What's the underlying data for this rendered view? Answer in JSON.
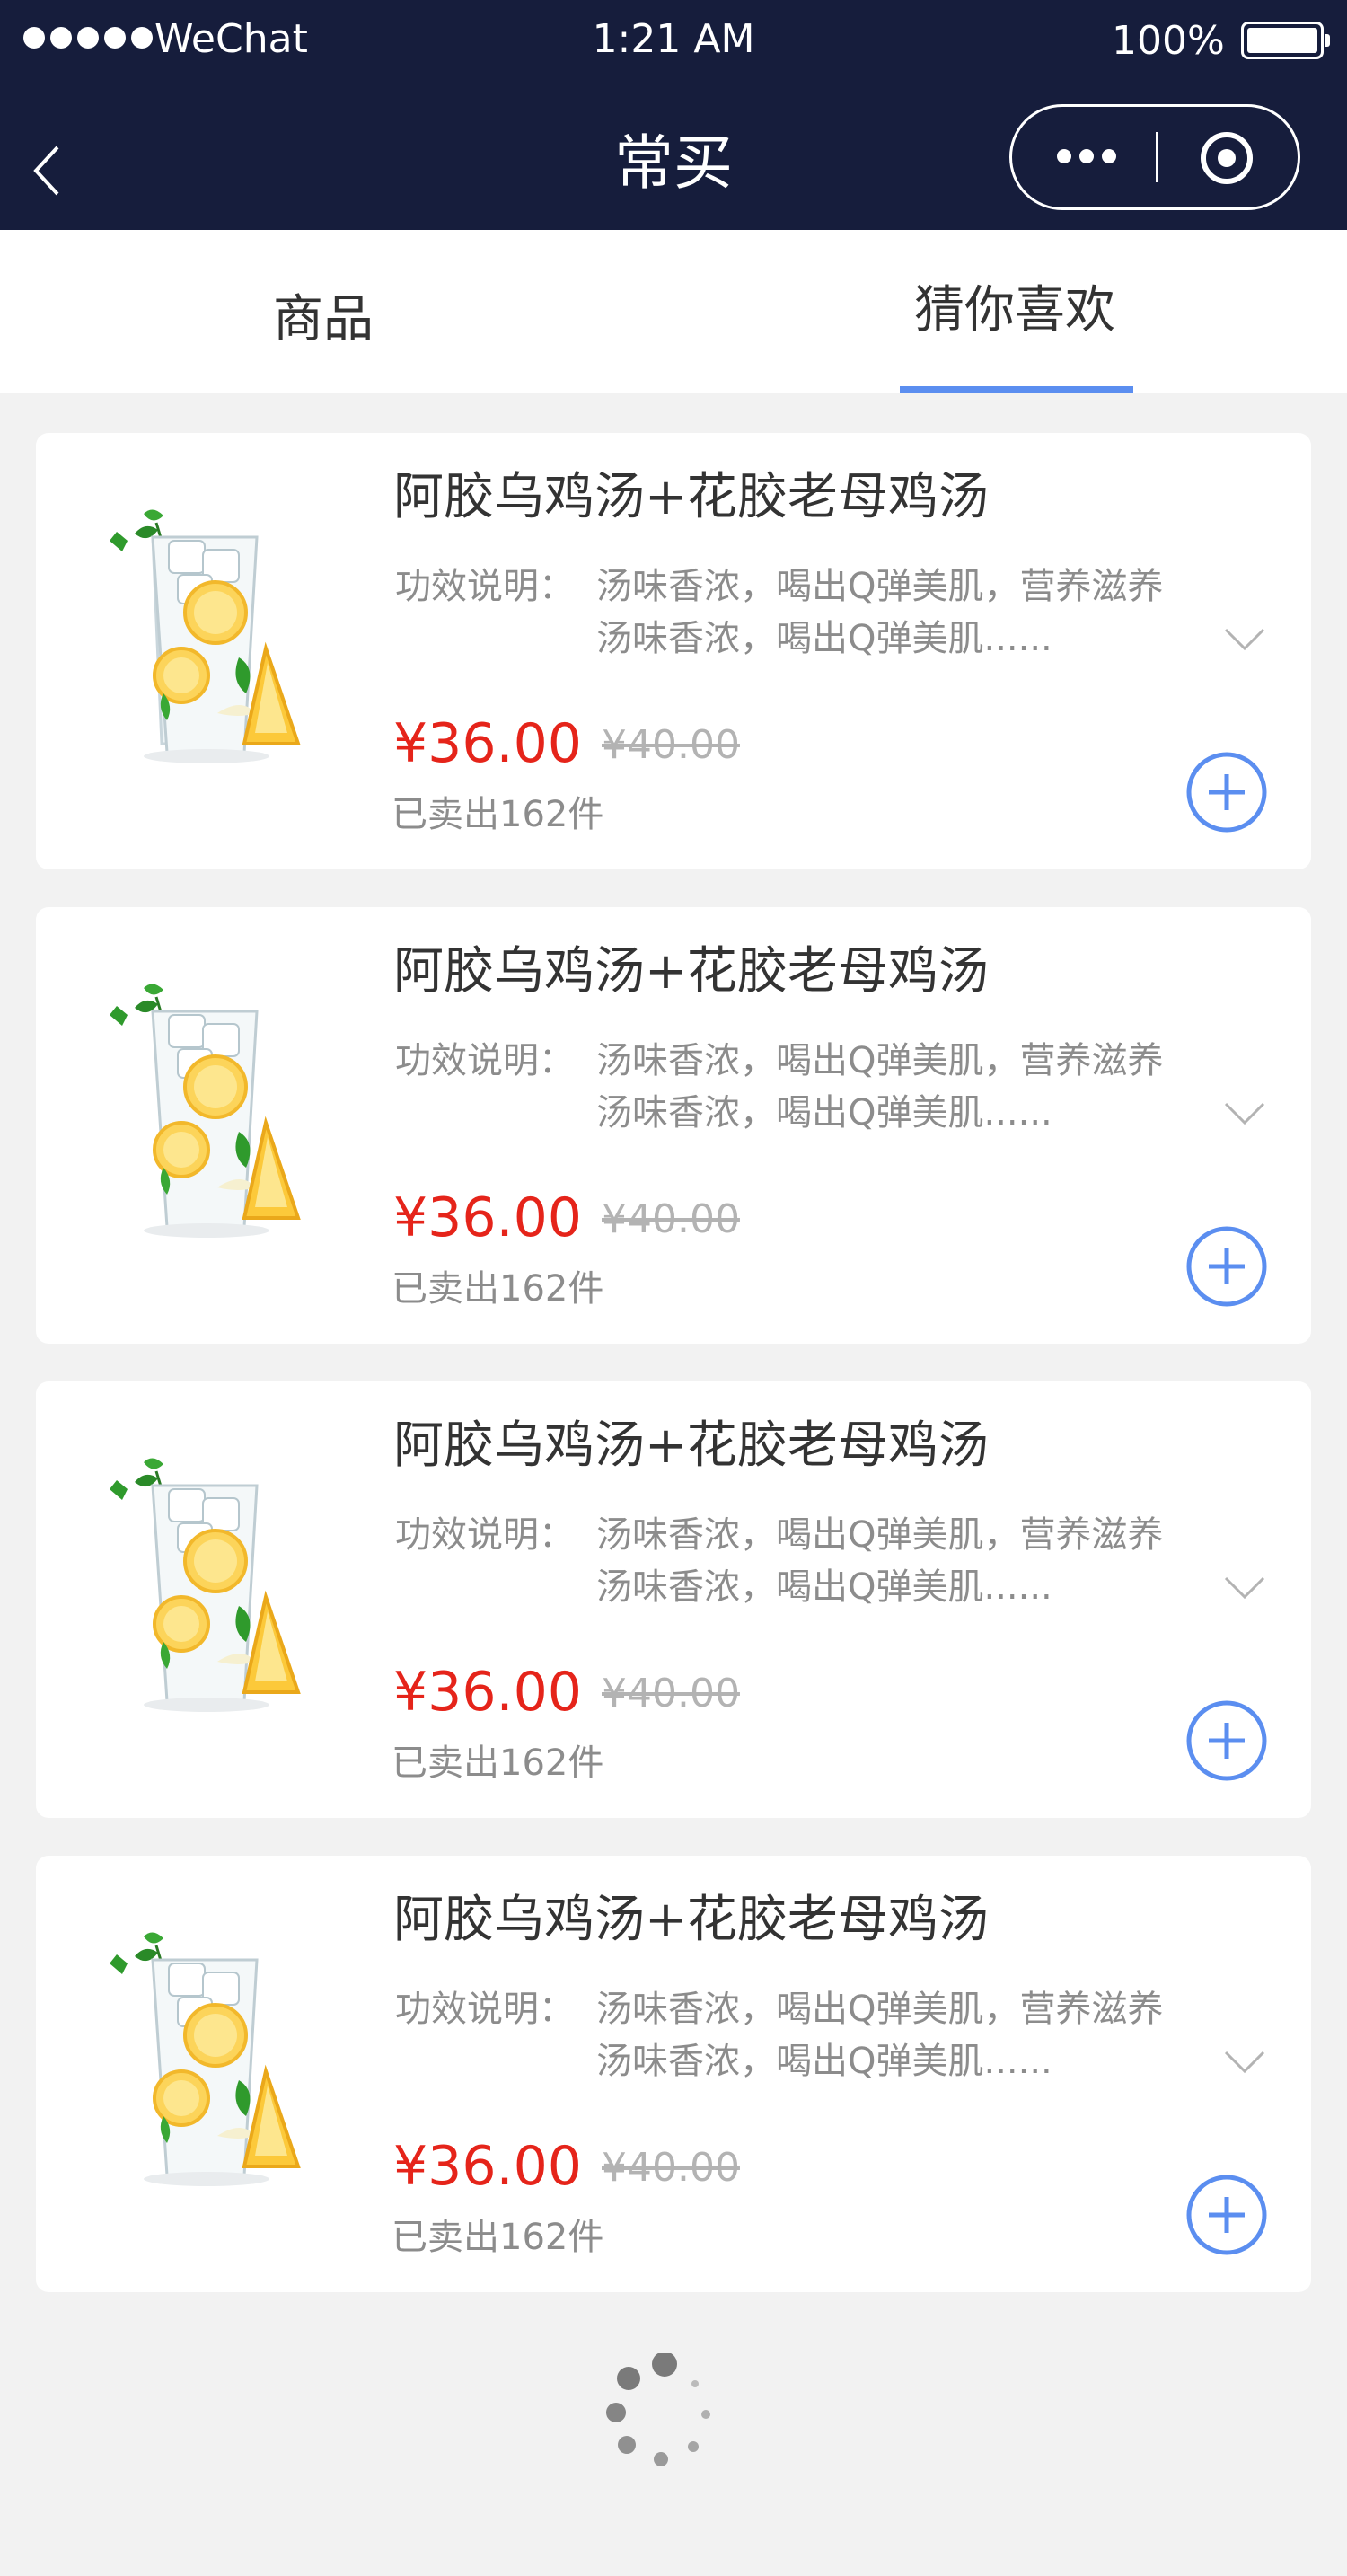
{
  "status_bar": {
    "carrier": "WeChat",
    "time": "1:21 AM",
    "battery": "100%"
  },
  "nav": {
    "title": "常买"
  },
  "tabs": [
    {
      "label": "商品",
      "active": false
    },
    {
      "label": "猜你喜欢",
      "active": true
    }
  ],
  "products": [
    {
      "name": "阿胶乌鸡汤+花胶老母鸡汤",
      "desc_label": "功效说明：",
      "desc_line1": "汤味香浓，喝出Q弹美肌，营养滋养",
      "desc_line2": "汤味香浓，喝出Q弹美肌......",
      "price": "¥36.00",
      "original_price": "¥40.00",
      "sold": "已卖出162件"
    },
    {
      "name": "阿胶乌鸡汤+花胶老母鸡汤",
      "desc_label": "功效说明：",
      "desc_line1": "汤味香浓，喝出Q弹美肌，营养滋养",
      "desc_line2": "汤味香浓，喝出Q弹美肌......",
      "price": "¥36.00",
      "original_price": "¥40.00",
      "sold": "已卖出162件"
    },
    {
      "name": "阿胶乌鸡汤+花胶老母鸡汤",
      "desc_label": "功效说明：",
      "desc_line1": "汤味香浓，喝出Q弹美肌，营养滋养",
      "desc_line2": "汤味香浓，喝出Q弹美肌......",
      "price": "¥36.00",
      "original_price": "¥40.00",
      "sold": "已卖出162件"
    },
    {
      "name": "阿胶乌鸡汤+花胶老母鸡汤",
      "desc_label": "功效说明：",
      "desc_line1": "汤味香浓，喝出Q弹美肌，营养滋养",
      "desc_line2": "汤味香浓，喝出Q弹美肌......",
      "price": "¥36.00",
      "original_price": "¥40.00",
      "sold": "已卖出162件"
    }
  ],
  "colors": {
    "header_bg": "#161d3c",
    "accent": "#5b8ef0",
    "price": "#e5241a",
    "page_bg": "#f2f2f2"
  },
  "icons": {
    "back": "chevron-left-icon",
    "more": "more-dots-icon",
    "close": "target-circle-icon",
    "expand": "chevron-down-icon",
    "add": "plus-circle-icon",
    "loading": "loading-spinner-icon"
  }
}
